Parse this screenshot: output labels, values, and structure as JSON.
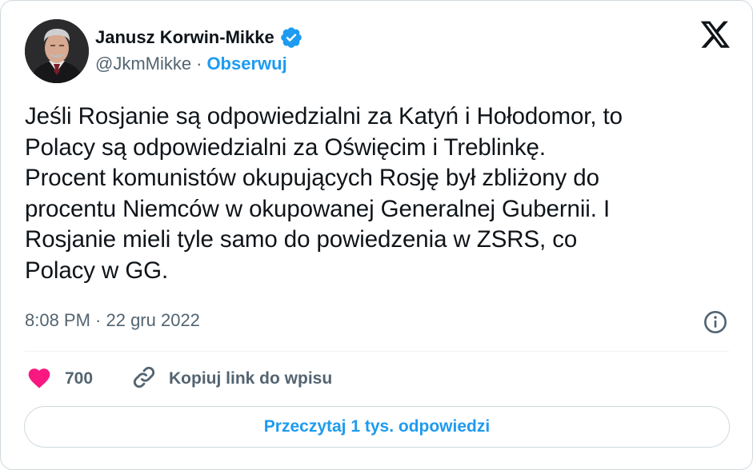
{
  "author": {
    "name": "Janusz Korwin-Mikke",
    "handle": "@JkmMikke",
    "separator": "·",
    "follow_label": "Obserwuj",
    "verified_icon": "verified-badge-icon"
  },
  "tweet": {
    "text": "Jeśli Rosjanie są odpowiedzialni za Katyń i Hołodomor, to\nPolacy są odpowiedzialni za Oświęcim i Treblinkę.\nProcent komunistów okupujących Rosję był zbliżony do\nprocentu Niemców w okupowanej Generalnej Gubernii. I\nRosjanie mieli tyle samo do powiedzenia w ZSRS, co\nPolacy w GG.",
    "timestamp": "8:08 PM · 22 gru 2022"
  },
  "actions": {
    "like_count": "700",
    "copy_link_label": "Kopiuj link do wpisu",
    "read_replies_label": "Przeczytaj 1 tys. odpowiedzi"
  },
  "colors": {
    "accent": "#1d9bf0",
    "like": "#f91880",
    "muted": "#536471",
    "text": "#0f1419",
    "border": "#cfd9de"
  }
}
